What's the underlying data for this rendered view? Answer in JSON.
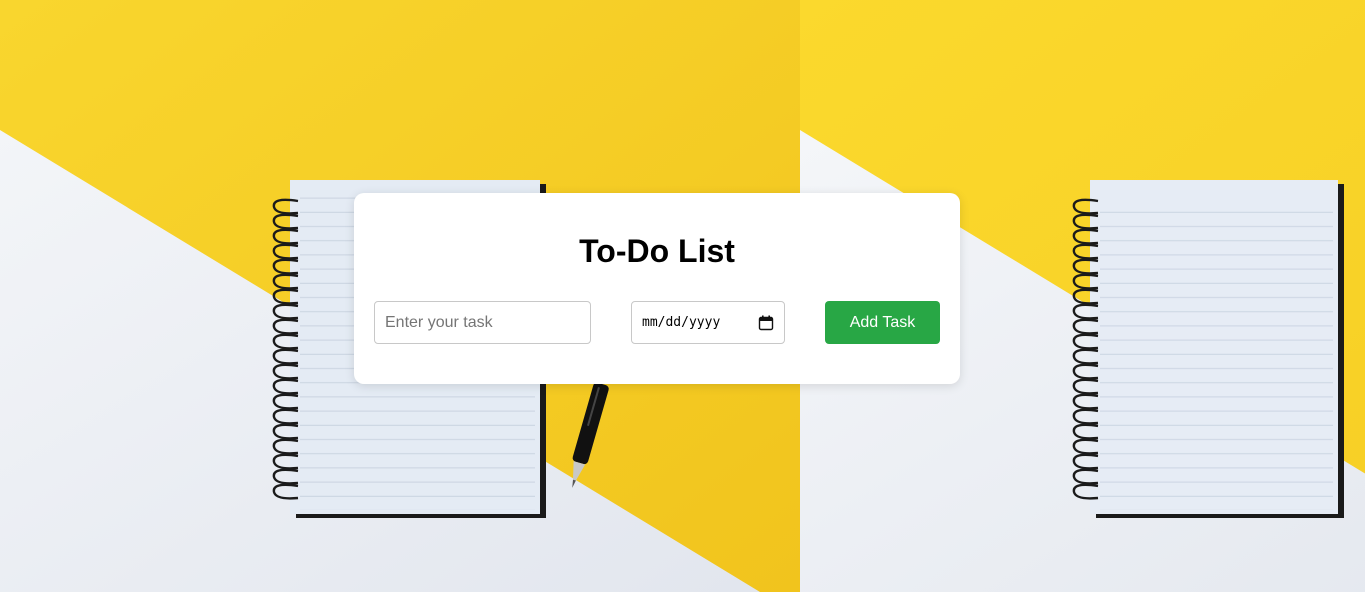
{
  "app": {
    "title": "To-Do List"
  },
  "form": {
    "task_placeholder": "Enter your task",
    "task_value": "",
    "date_placeholder": "mm/dd/yyyy",
    "add_button_label": "Add Task"
  },
  "theme": {
    "button_color": "#28a745",
    "background_yellow": "#f6cf23",
    "background_white": "#e9edf3"
  },
  "icons": {
    "calendar": "calendar-icon"
  }
}
